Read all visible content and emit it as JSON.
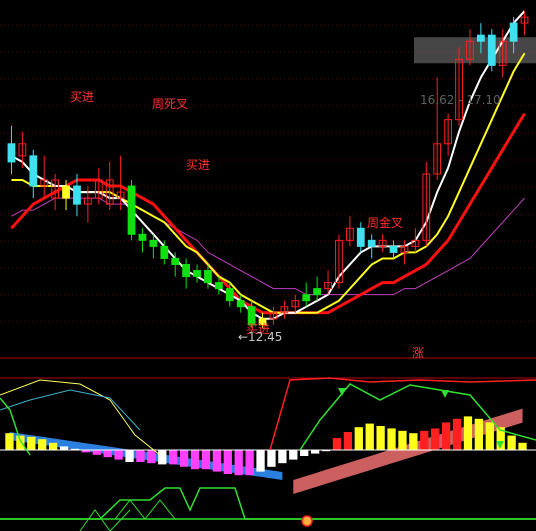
{
  "chart_data": [
    {
      "type": "candlestick",
      "panel": "price",
      "annotations": {
        "buy_label": "买进",
        "dead_cross_label": "周死叉",
        "golden_cross_label": "周金叉",
        "low_price_label": "←12.45",
        "range_label": "16.62 - 17.10"
      },
      "low_price": 12.45,
      "range_band": [
        16.62,
        17.1
      ],
      "candles": [
        {
          "o": 15.2,
          "c": 15.5,
          "h": 15.8,
          "l": 15.0,
          "col": "cyan"
        },
        {
          "o": 15.5,
          "c": 15.3,
          "h": 15.7,
          "l": 15.1,
          "col": "red"
        },
        {
          "o": 15.3,
          "c": 14.8,
          "h": 15.4,
          "l": 14.6,
          "col": "cyan"
        },
        {
          "o": 14.8,
          "c": 14.9,
          "h": 15.3,
          "l": 14.6,
          "col": "red"
        },
        {
          "o": 14.9,
          "c": 14.6,
          "h": 15.0,
          "l": 14.4,
          "col": "red"
        },
        {
          "o": 14.6,
          "c": 14.8,
          "h": 14.9,
          "l": 14.4,
          "col": "yellow"
        },
        {
          "o": 14.8,
          "c": 14.5,
          "h": 15.0,
          "l": 14.3,
          "col": "cyan"
        },
        {
          "o": 14.5,
          "c": 14.6,
          "h": 14.8,
          "l": 14.2,
          "col": "red"
        },
        {
          "o": 14.6,
          "c": 14.9,
          "h": 15.1,
          "l": 14.5,
          "col": "red"
        },
        {
          "o": 14.9,
          "c": 14.5,
          "h": 15.2,
          "l": 14.4,
          "col": "red"
        },
        {
          "o": 14.6,
          "c": 14.7,
          "h": 15.3,
          "l": 14.4,
          "col": "red"
        },
        {
          "o": 14.8,
          "c": 14.0,
          "h": 14.9,
          "l": 13.9,
          "col": "green"
        },
        {
          "o": 14.0,
          "c": 13.9,
          "h": 14.1,
          "l": 13.7,
          "col": "green"
        },
        {
          "o": 13.9,
          "c": 13.8,
          "h": 14.0,
          "l": 13.6,
          "col": "green"
        },
        {
          "o": 13.8,
          "c": 13.6,
          "h": 13.9,
          "l": 13.5,
          "col": "green"
        },
        {
          "o": 13.6,
          "c": 13.5,
          "h": 13.7,
          "l": 13.3,
          "col": "green"
        },
        {
          "o": 13.5,
          "c": 13.3,
          "h": 13.6,
          "l": 13.1,
          "col": "green"
        },
        {
          "o": 13.3,
          "c": 13.4,
          "h": 13.5,
          "l": 13.2,
          "col": "green"
        },
        {
          "o": 13.4,
          "c": 13.2,
          "h": 13.5,
          "l": 13.1,
          "col": "green"
        },
        {
          "o": 13.2,
          "c": 13.1,
          "h": 13.3,
          "l": 13.0,
          "col": "green"
        },
        {
          "o": 13.1,
          "c": 12.9,
          "h": 13.2,
          "l": 12.8,
          "col": "green"
        },
        {
          "o": 12.9,
          "c": 12.8,
          "h": 13.0,
          "l": 12.7,
          "col": "green"
        },
        {
          "o": 12.8,
          "c": 12.5,
          "h": 12.9,
          "l": 12.45,
          "col": "green"
        },
        {
          "o": 12.5,
          "c": 12.6,
          "h": 12.7,
          "l": 12.45,
          "col": "yellow"
        },
        {
          "o": 12.6,
          "c": 12.7,
          "h": 12.8,
          "l": 12.5,
          "col": "red"
        },
        {
          "o": 12.7,
          "c": 12.8,
          "h": 12.9,
          "l": 12.6,
          "col": "red"
        },
        {
          "o": 12.8,
          "c": 12.9,
          "h": 13.0,
          "l": 12.7,
          "col": "red"
        },
        {
          "o": 12.9,
          "c": 13.0,
          "h": 13.2,
          "l": 12.8,
          "col": "green"
        },
        {
          "o": 13.0,
          "c": 13.1,
          "h": 13.3,
          "l": 12.9,
          "col": "green"
        },
        {
          "o": 13.1,
          "c": 13.2,
          "h": 13.4,
          "l": 13.0,
          "col": "red"
        },
        {
          "o": 13.2,
          "c": 13.9,
          "h": 14.0,
          "l": 13.1,
          "col": "red"
        },
        {
          "o": 13.9,
          "c": 14.1,
          "h": 14.3,
          "l": 13.8,
          "col": "red"
        },
        {
          "o": 14.1,
          "c": 13.8,
          "h": 14.2,
          "l": 13.7,
          "col": "cyan"
        },
        {
          "o": 13.8,
          "c": 13.9,
          "h": 14.0,
          "l": 13.6,
          "col": "cyan"
        },
        {
          "o": 13.9,
          "c": 13.8,
          "h": 14.0,
          "l": 13.7,
          "col": "red"
        },
        {
          "o": 13.8,
          "c": 13.7,
          "h": 13.9,
          "l": 13.6,
          "col": "cyan"
        },
        {
          "o": 13.7,
          "c": 13.8,
          "h": 13.9,
          "l": 13.5,
          "col": "red"
        },
        {
          "o": 13.8,
          "c": 13.9,
          "h": 14.1,
          "l": 13.7,
          "col": "red"
        },
        {
          "o": 13.9,
          "c": 15.0,
          "h": 15.2,
          "l": 13.8,
          "col": "red"
        },
        {
          "o": 15.0,
          "c": 15.5,
          "h": 16.6,
          "l": 14.9,
          "col": "red"
        },
        {
          "o": 15.5,
          "c": 15.9,
          "h": 16.0,
          "l": 15.3,
          "col": "red"
        },
        {
          "o": 15.9,
          "c": 16.9,
          "h": 17.1,
          "l": 15.8,
          "col": "red"
        },
        {
          "o": 16.9,
          "c": 17.2,
          "h": 17.4,
          "l": 16.8,
          "col": "red"
        },
        {
          "o": 17.2,
          "c": 17.3,
          "h": 17.5,
          "l": 17.0,
          "col": "cyan"
        },
        {
          "o": 17.3,
          "c": 16.8,
          "h": 17.4,
          "l": 16.7,
          "col": "cyan"
        },
        {
          "o": 16.8,
          "c": 17.2,
          "h": 17.4,
          "l": 16.6,
          "col": "red"
        },
        {
          "o": 17.2,
          "c": 17.5,
          "h": 17.6,
          "l": 17.0,
          "col": "cyan"
        },
        {
          "o": 17.5,
          "c": 17.6,
          "h": 17.7,
          "l": 17.3,
          "col": "red"
        }
      ],
      "ma_short": [
        15.3,
        15.2,
        15.0,
        14.9,
        14.8,
        14.8,
        14.7,
        14.7,
        14.7,
        14.6,
        14.6,
        14.4,
        14.2,
        14.0,
        13.8,
        13.6,
        13.4,
        13.3,
        13.2,
        13.1,
        13.0,
        12.9,
        12.7,
        12.6,
        12.6,
        12.7,
        12.7,
        12.8,
        12.9,
        13.0,
        13.3,
        13.5,
        13.7,
        13.8,
        13.8,
        13.8,
        13.8,
        13.9,
        14.2,
        14.7,
        15.1,
        15.7,
        16.2,
        16.6,
        16.9,
        17.2,
        17.5,
        17.7
      ],
      "ma_mid": [
        14.9,
        14.9,
        14.8,
        14.8,
        14.8,
        14.8,
        14.7,
        14.7,
        14.7,
        14.7,
        14.6,
        14.5,
        14.4,
        14.3,
        14.2,
        14.0,
        13.8,
        13.7,
        13.5,
        13.3,
        13.2,
        13.0,
        12.9,
        12.8,
        12.7,
        12.7,
        12.7,
        12.7,
        12.7,
        12.8,
        12.9,
        13.1,
        13.3,
        13.5,
        13.6,
        13.6,
        13.7,
        13.7,
        13.8,
        14.0,
        14.3,
        14.7,
        15.1,
        15.5,
        15.9,
        16.3,
        16.7,
        17.0
      ],
      "ma_long": [
        14.1,
        14.3,
        14.5,
        14.6,
        14.7,
        14.8,
        14.9,
        14.9,
        14.9,
        14.8,
        14.8,
        14.7,
        14.6,
        14.5,
        14.3,
        14.1,
        13.9,
        13.7,
        13.5,
        13.3,
        13.1,
        12.9,
        12.8,
        12.7,
        12.7,
        12.7,
        12.7,
        12.7,
        12.7,
        12.7,
        12.8,
        12.9,
        13.0,
        13.1,
        13.2,
        13.2,
        13.3,
        13.4,
        13.5,
        13.7,
        13.9,
        14.2,
        14.5,
        14.8,
        15.1,
        15.4,
        15.7,
        16.0
      ],
      "ma_very_long": [
        14.3,
        14.4,
        14.4,
        14.5,
        14.6,
        14.6,
        14.6,
        14.6,
        14.6,
        14.5,
        14.5,
        14.5,
        14.4,
        14.3,
        14.2,
        14.1,
        14.0,
        13.9,
        13.7,
        13.6,
        13.5,
        13.4,
        13.3,
        13.2,
        13.1,
        13.1,
        13.1,
        13.0,
        13.0,
        13.0,
        13.0,
        13.0,
        13.0,
        13.0,
        13.0,
        13.0,
        13.1,
        13.1,
        13.2,
        13.3,
        13.4,
        13.5,
        13.6,
        13.8,
        14.0,
        14.2,
        14.4,
        14.6
      ]
    },
    {
      "type": "bar",
      "panel": "macd",
      "label": "涨",
      "bars": [
        1.4,
        1.2,
        1.1,
        0.9,
        0.6,
        0.3,
        0.1,
        -0.2,
        -0.4,
        -0.6,
        -0.8,
        -1.0,
        -1.0,
        -1.1,
        -1.2,
        -1.2,
        -1.4,
        -1.6,
        -1.6,
        -1.8,
        -2.0,
        -2.1,
        -2.1,
        -1.8,
        -1.4,
        -1.1,
        -0.8,
        -0.5,
        -0.3,
        -0.1,
        1.0,
        1.5,
        1.9,
        2.2,
        2.0,
        1.8,
        1.6,
        1.4,
        1.6,
        1.8,
        2.3,
        2.6,
        2.8,
        2.6,
        2.3,
        1.9,
        1.2,
        0.6
      ],
      "bar_colors": [
        "yellow",
        "yellow",
        "yellow",
        "yellow",
        "yellow",
        "white",
        "white",
        "magenta",
        "magenta",
        "magenta",
        "magenta",
        "white",
        "magenta",
        "magenta",
        "white",
        "magenta",
        "magenta",
        "magenta",
        "magenta",
        "magenta",
        "magenta",
        "magenta",
        "magenta",
        "white",
        "white",
        "white",
        "white",
        "white",
        "white",
        "white",
        "red",
        "red",
        "yellow",
        "yellow",
        "yellow",
        "yellow",
        "yellow",
        "yellow",
        "red",
        "red",
        "red",
        "red",
        "yellow",
        "yellow",
        "yellow",
        "yellow",
        "yellow",
        "yellow"
      ]
    }
  ]
}
